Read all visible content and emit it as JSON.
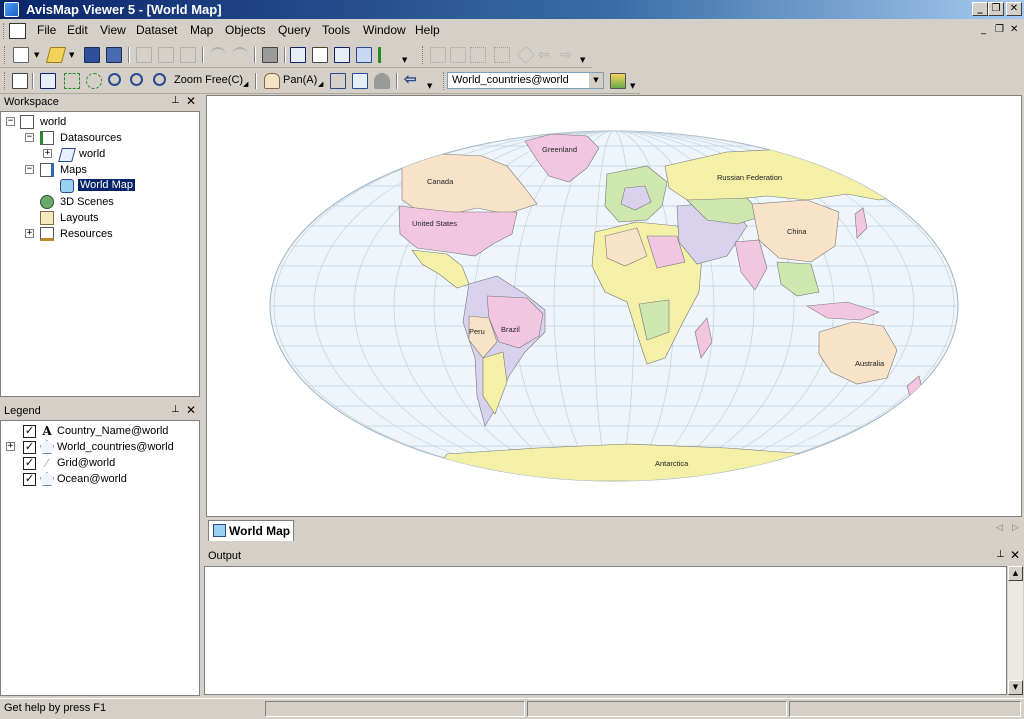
{
  "window": {
    "title": "AvisMap Viewer 5 - [World Map]",
    "minimize_glyph": "_",
    "restore_glyph": "❐",
    "close_glyph": "✕"
  },
  "menu": {
    "items": [
      "File",
      "Edit",
      "View",
      "Dataset",
      "Map",
      "Objects",
      "Query",
      "Tools",
      "Window",
      "Help"
    ]
  },
  "toolbar2": {
    "zoom_free_label": "Zoom Free(C)",
    "pan_label": "Pan(A)",
    "layer_combo_value": "World_countries@world"
  },
  "workspace": {
    "title": "Workspace",
    "root": "world",
    "datasources_label": "Datasources",
    "datasource_world": "world",
    "maps_label": "Maps",
    "map_world": "World Map",
    "scenes_label": "3D Scenes",
    "layouts_label": "Layouts",
    "resources_label": "Resources"
  },
  "legend": {
    "title": "Legend",
    "layers": [
      {
        "name": "Country_Name@world",
        "checked": true,
        "icon": "text-layer-icon"
      },
      {
        "name": "World_countries@world",
        "checked": true,
        "icon": "region-layer-icon"
      },
      {
        "name": "Grid@world",
        "checked": true,
        "icon": "line-layer-icon"
      },
      {
        "name": "Ocean@world",
        "checked": true,
        "icon": "region-layer-icon"
      }
    ]
  },
  "map": {
    "labels": {
      "greenland": "Greenland",
      "canada": "Canada",
      "russia": "Russian Federation",
      "usa": "United States",
      "china": "China",
      "brazil": "Brazil",
      "peru": "Peru",
      "australia": "Australia",
      "antarctica": "Antarctica"
    },
    "colors": {
      "ocean": "#eef6fb",
      "grid": "#b9c9d6",
      "pink": "#f2c6e0",
      "yellow": "#f4f0a8",
      "green": "#cfe8b0",
      "lavender": "#d8d2ee",
      "peach": "#f8e2c8"
    }
  },
  "tabs": {
    "active": "World Map"
  },
  "output": {
    "title": "Output"
  },
  "status": {
    "help_text": "Get help by press F1"
  }
}
